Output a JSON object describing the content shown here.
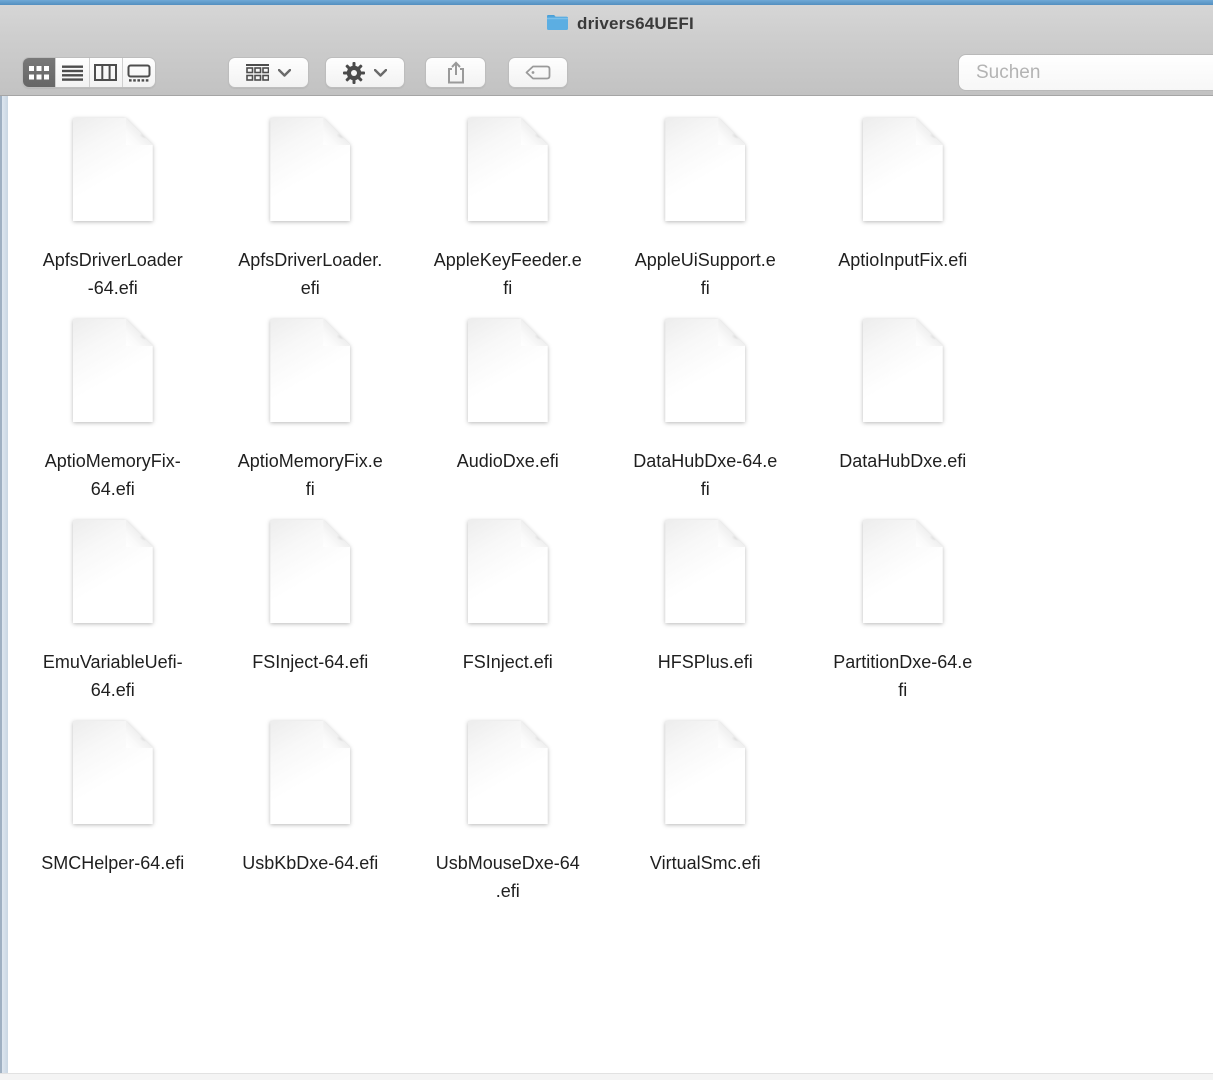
{
  "window": {
    "title": "drivers64UEFI",
    "title_icon": "folder-icon"
  },
  "toolbar": {
    "view_segments": [
      {
        "id": "icon-view",
        "selected": true
      },
      {
        "id": "list-view",
        "selected": false
      },
      {
        "id": "column-view",
        "selected": false
      },
      {
        "id": "gallery-view",
        "selected": false
      }
    ],
    "arrange_button": {
      "icon": "arrange-icon",
      "has_chevron": true
    },
    "action_button": {
      "icon": "gear-icon",
      "has_chevron": true
    },
    "share_button": {
      "icon": "share-icon",
      "enabled": false
    },
    "tags_button": {
      "icon": "tag-icon",
      "enabled": false
    },
    "search": {
      "placeholder": "Suchen",
      "value": "",
      "icon": "search-icon"
    }
  },
  "colors": {
    "accent_blue_strip": "#5b9ccd",
    "chrome_top": "#d6d6d6",
    "chrome_bottom": "#c2c2c2",
    "selected_segment": "#6d6d6d",
    "folder_blue": "#5caee2",
    "label_text": "#1f1f1f",
    "placeholder_gray": "#b3b3b3"
  },
  "files": [
    {
      "name": "ApfsDriverLoader-64.efi",
      "label_lines": [
        "ApfsDriverLoader",
        "-64.efi"
      ]
    },
    {
      "name": "ApfsDriverLoader.efi",
      "label_lines": [
        "ApfsDriverLoader.",
        "efi"
      ]
    },
    {
      "name": "AppleKeyFeeder.efi",
      "label_lines": [
        "AppleKeyFeeder.e",
        "fi"
      ]
    },
    {
      "name": "AppleUiSupport.efi",
      "label_lines": [
        "AppleUiSupport.e",
        "fi"
      ]
    },
    {
      "name": "AptioInputFix.efi",
      "label_lines": [
        "AptioInputFix.efi"
      ]
    },
    {
      "name": "AptioMemoryFix-64.efi",
      "label_lines": [
        "AptioMemoryFix-",
        "64.efi"
      ]
    },
    {
      "name": "AptioMemoryFix.efi",
      "label_lines": [
        "AptioMemoryFix.e",
        "fi"
      ]
    },
    {
      "name": "AudioDxe.efi",
      "label_lines": [
        "AudioDxe.efi"
      ]
    },
    {
      "name": "DataHubDxe-64.efi",
      "label_lines": [
        "DataHubDxe-64.e",
        "fi"
      ]
    },
    {
      "name": "DataHubDxe.efi",
      "label_lines": [
        "DataHubDxe.efi"
      ]
    },
    {
      "name": "EmuVariableUefi-64.efi",
      "label_lines": [
        "EmuVariableUefi-",
        "64.efi"
      ]
    },
    {
      "name": "FSInject-64.efi",
      "label_lines": [
        "FSInject-64.efi"
      ]
    },
    {
      "name": "FSInject.efi",
      "label_lines": [
        "FSInject.efi"
      ]
    },
    {
      "name": "HFSPlus.efi",
      "label_lines": [
        "HFSPlus.efi"
      ]
    },
    {
      "name": "PartitionDxe-64.efi",
      "label_lines": [
        "PartitionDxe-64.e",
        "fi"
      ]
    },
    {
      "name": "SMCHelper-64.efi",
      "label_lines": [
        "SMCHelper-64.efi"
      ]
    },
    {
      "name": "UsbKbDxe-64.efi",
      "label_lines": [
        "UsbKbDxe-64.efi"
      ]
    },
    {
      "name": "UsbMouseDxe-64.efi",
      "label_lines": [
        "UsbMouseDxe-64",
        ".efi"
      ]
    },
    {
      "name": "VirtualSmc.efi",
      "label_lines": [
        "VirtualSmc.efi"
      ]
    }
  ]
}
